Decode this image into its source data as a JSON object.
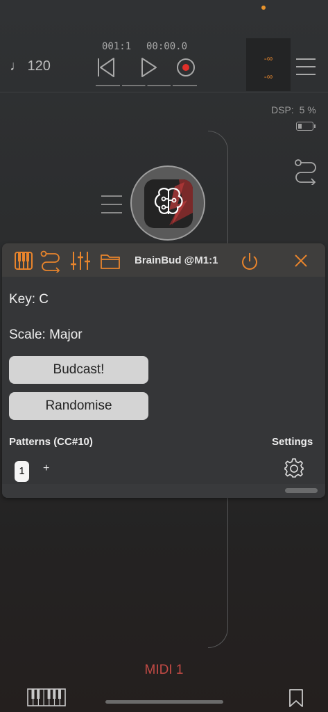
{
  "header": {
    "tempo_text": "♩ 120",
    "position": "001:1",
    "time": "00:00.0",
    "meter_top": "-∞",
    "meter_bottom": "-∞"
  },
  "status": {
    "dsp_label": "DSP:",
    "dsp_value": "5 %"
  },
  "panel": {
    "title": "BrainBud @M1:1",
    "key_label": "Key: C",
    "scale_label": "Scale: Major",
    "budcast_button": "Budcast!",
    "randomise_button": "Randomise",
    "patterns_label": "Patterns (CC#10)",
    "settings_label": "Settings",
    "pattern_items": [
      "1"
    ],
    "add_pattern": "+"
  },
  "footer": {
    "channel_label": "MIDI 1"
  },
  "colors": {
    "accent": "#e8842c",
    "midi_label": "#c24a45",
    "record": "#e0302a"
  },
  "icons": [
    "piano-icon",
    "routing-icon",
    "mixer-icon",
    "folder-icon",
    "power-icon",
    "close-icon",
    "gear-icon",
    "rewind-icon",
    "play-icon",
    "record-icon",
    "menu-icon",
    "bookmark-icon",
    "keyboard-icon",
    "brain-icon"
  ]
}
